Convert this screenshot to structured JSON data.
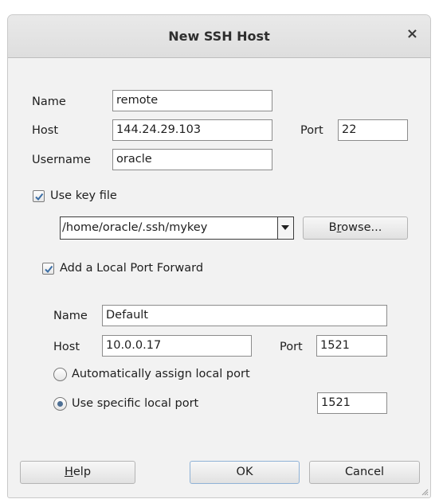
{
  "dialog": {
    "title": "New SSH Host",
    "close_glyph": "×"
  },
  "form": {
    "name_label": "Name",
    "name_value": "remote",
    "host_label": "Host",
    "host_value": "144.24.29.103",
    "port_label": "Port",
    "port_value": "22",
    "username_label": "Username",
    "username_value": "oracle",
    "use_key_file_label": "Use key file",
    "use_key_file_checked": true,
    "key_file_path": "/home/oracle/.ssh/mykey",
    "browse_prefix": "B",
    "browse_mnemonic": "r",
    "browse_suffix": "owse..."
  },
  "port_forward": {
    "enable_label": "Add a Local Port Forward",
    "enabled": true,
    "name_label": "Name",
    "name_value": "Default",
    "host_label": "Host",
    "host_value": "10.0.0.17",
    "port_label": "Port",
    "port_value": "1521",
    "auto_port_label": "Automatically assign local port",
    "specific_port_label": "Use specific local port",
    "selected_option": "specific",
    "local_port_value": "1521"
  },
  "buttons": {
    "help_mnemonic": "H",
    "help_rest": "elp",
    "ok": "OK",
    "cancel": "Cancel"
  },
  "colors": {
    "check_mark": "#3b6ea5",
    "radio_dot": "#4d6f94",
    "default_button_border": "#8fb2d6"
  }
}
